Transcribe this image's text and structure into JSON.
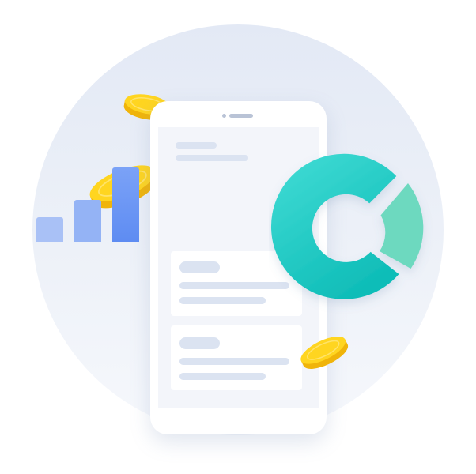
{
  "illustration": {
    "colors": {
      "backdrop": "#e8edf6",
      "phone_body": "#ffffff",
      "screen": "#f3f5fa",
      "skeleton": "#dbe3f1",
      "bar_light": "#a8c0f7",
      "bar_dark": "#6f97f4",
      "donut_main": "#2ccfc6",
      "donut_segment": "#6cd8bf",
      "coin_gold": "#ffd21c",
      "coin_edge": "#f2b90a"
    },
    "icons": {
      "phone": "smartphone-icon",
      "chart": "bar-chart-icon",
      "donut": "donut-chart-icon",
      "coin": "gold-coin-icon"
    },
    "bar_levels": [
      0.33,
      0.56,
      1.0
    ]
  }
}
